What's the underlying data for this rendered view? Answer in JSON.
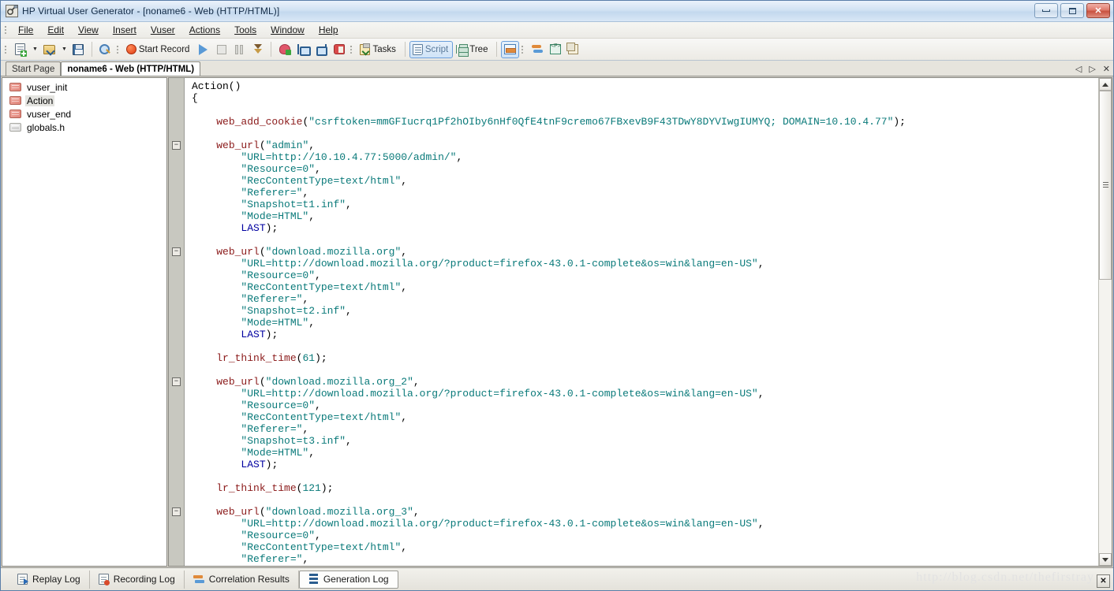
{
  "window": {
    "title": "HP Virtual User Generator - [noname6 - Web (HTTP/HTML)]",
    "app_icon": "vugen-app-icon",
    "controls": {
      "minimize": "minimize-button",
      "restore": "restore-button",
      "close": "✕"
    }
  },
  "menubar": {
    "items": [
      {
        "label": "File"
      },
      {
        "label": "Edit"
      },
      {
        "label": "View"
      },
      {
        "label": "Insert"
      },
      {
        "label": "Vuser"
      },
      {
        "label": "Actions"
      },
      {
        "label": "Tools"
      },
      {
        "label": "Window"
      },
      {
        "label": "Help"
      }
    ]
  },
  "toolbar": {
    "new_script": "new-script-icon",
    "open_script": "open-folder-icon",
    "save_script": "save-floppy-icon",
    "find": "find-zoom-icon",
    "start_record_label": "Start Record",
    "run": "run-play-icon",
    "stop": "stop-icon",
    "pause": "pause-icon",
    "step_down": "step-down-icon",
    "design_studio": "design-studio-icon",
    "step_into": "step-into-icon",
    "step_out": "step-out-icon",
    "breakpoint": "breakpoint-icon",
    "tasks_label": "Tasks",
    "script_label": "Script",
    "tree_label": "Tree",
    "split_view": "split-view-icon",
    "sync_icon": "sync-icon",
    "parameter_icon": "parameter-icon",
    "copy_icon": "copy-icon"
  },
  "doctabs": {
    "tabs": [
      {
        "label": "Start Page",
        "active": false
      },
      {
        "label": "noname6 - Web (HTTP/HTML)",
        "active": true
      }
    ],
    "nav": {
      "prev": "◁",
      "next": "▷",
      "close": "✕"
    }
  },
  "tree": {
    "items": [
      {
        "label": "vuser_init",
        "icon": "action-brick-icon",
        "selected": false
      },
      {
        "label": "Action",
        "icon": "action-brick-icon",
        "selected": true
      },
      {
        "label": "vuser_end",
        "icon": "action-brick-icon",
        "selected": false
      },
      {
        "label": "globals.h",
        "icon": "header-file-icon",
        "selected": false
      }
    ]
  },
  "editor": {
    "code_lines": [
      [
        {
          "t": "Action()",
          "c": "pun"
        }
      ],
      [
        {
          "t": "{",
          "c": "pun"
        }
      ],
      [],
      [
        {
          "t": "    ",
          "c": "pun"
        },
        {
          "t": "web_add_cookie",
          "c": "fn"
        },
        {
          "t": "(",
          "c": "pun"
        },
        {
          "t": "\"csrftoken=mmGFIucrq1Pf2hOIby6nHf0QfE4tnF9cremo67FBxevB9F43TDwY8DYVIwgIUMYQ; DOMAIN=10.10.4.77\"",
          "c": "str"
        },
        {
          "t": ");",
          "c": "pun"
        }
      ],
      [],
      [
        {
          "t": "    ",
          "c": "pun"
        },
        {
          "t": "web_url",
          "c": "fn"
        },
        {
          "t": "(",
          "c": "pun"
        },
        {
          "t": "\"admin\"",
          "c": "str"
        },
        {
          "t": ",",
          "c": "pun"
        }
      ],
      [
        {
          "t": "        ",
          "c": "pun"
        },
        {
          "t": "\"URL=http://10.10.4.77:5000/admin/\"",
          "c": "str"
        },
        {
          "t": ",",
          "c": "pun"
        }
      ],
      [
        {
          "t": "        ",
          "c": "pun"
        },
        {
          "t": "\"Resource=0\"",
          "c": "str"
        },
        {
          "t": ",",
          "c": "pun"
        }
      ],
      [
        {
          "t": "        ",
          "c": "pun"
        },
        {
          "t": "\"RecContentType=text/html\"",
          "c": "str"
        },
        {
          "t": ",",
          "c": "pun"
        }
      ],
      [
        {
          "t": "        ",
          "c": "pun"
        },
        {
          "t": "\"Referer=\"",
          "c": "str"
        },
        {
          "t": ",",
          "c": "pun"
        }
      ],
      [
        {
          "t": "        ",
          "c": "pun"
        },
        {
          "t": "\"Snapshot=t1.inf\"",
          "c": "str"
        },
        {
          "t": ",",
          "c": "pun"
        }
      ],
      [
        {
          "t": "        ",
          "c": "pun"
        },
        {
          "t": "\"Mode=HTML\"",
          "c": "str"
        },
        {
          "t": ",",
          "c": "pun"
        }
      ],
      [
        {
          "t": "        ",
          "c": "pun"
        },
        {
          "t": "LAST",
          "c": "kw"
        },
        {
          "t": ");",
          "c": "pun"
        }
      ],
      [],
      [
        {
          "t": "    ",
          "c": "pun"
        },
        {
          "t": "web_url",
          "c": "fn"
        },
        {
          "t": "(",
          "c": "pun"
        },
        {
          "t": "\"download.mozilla.org\"",
          "c": "str"
        },
        {
          "t": ",",
          "c": "pun"
        }
      ],
      [
        {
          "t": "        ",
          "c": "pun"
        },
        {
          "t": "\"URL=http://download.mozilla.org/?product=firefox-43.0.1-complete&os=win&lang=en-US\"",
          "c": "str"
        },
        {
          "t": ",",
          "c": "pun"
        }
      ],
      [
        {
          "t": "        ",
          "c": "pun"
        },
        {
          "t": "\"Resource=0\"",
          "c": "str"
        },
        {
          "t": ",",
          "c": "pun"
        }
      ],
      [
        {
          "t": "        ",
          "c": "pun"
        },
        {
          "t": "\"RecContentType=text/html\"",
          "c": "str"
        },
        {
          "t": ",",
          "c": "pun"
        }
      ],
      [
        {
          "t": "        ",
          "c": "pun"
        },
        {
          "t": "\"Referer=\"",
          "c": "str"
        },
        {
          "t": ",",
          "c": "pun"
        }
      ],
      [
        {
          "t": "        ",
          "c": "pun"
        },
        {
          "t": "\"Snapshot=t2.inf\"",
          "c": "str"
        },
        {
          "t": ",",
          "c": "pun"
        }
      ],
      [
        {
          "t": "        ",
          "c": "pun"
        },
        {
          "t": "\"Mode=HTML\"",
          "c": "str"
        },
        {
          "t": ",",
          "c": "pun"
        }
      ],
      [
        {
          "t": "        ",
          "c": "pun"
        },
        {
          "t": "LAST",
          "c": "kw"
        },
        {
          "t": ");",
          "c": "pun"
        }
      ],
      [],
      [
        {
          "t": "    ",
          "c": "pun"
        },
        {
          "t": "lr_think_time",
          "c": "fn"
        },
        {
          "t": "(",
          "c": "pun"
        },
        {
          "t": "61",
          "c": "num"
        },
        {
          "t": ");",
          "c": "pun"
        }
      ],
      [],
      [
        {
          "t": "    ",
          "c": "pun"
        },
        {
          "t": "web_url",
          "c": "fn"
        },
        {
          "t": "(",
          "c": "pun"
        },
        {
          "t": "\"download.mozilla.org_2\"",
          "c": "str"
        },
        {
          "t": ",",
          "c": "pun"
        }
      ],
      [
        {
          "t": "        ",
          "c": "pun"
        },
        {
          "t": "\"URL=http://download.mozilla.org/?product=firefox-43.0.1-complete&os=win&lang=en-US\"",
          "c": "str"
        },
        {
          "t": ",",
          "c": "pun"
        }
      ],
      [
        {
          "t": "        ",
          "c": "pun"
        },
        {
          "t": "\"Resource=0\"",
          "c": "str"
        },
        {
          "t": ",",
          "c": "pun"
        }
      ],
      [
        {
          "t": "        ",
          "c": "pun"
        },
        {
          "t": "\"RecContentType=text/html\"",
          "c": "str"
        },
        {
          "t": ",",
          "c": "pun"
        }
      ],
      [
        {
          "t": "        ",
          "c": "pun"
        },
        {
          "t": "\"Referer=\"",
          "c": "str"
        },
        {
          "t": ",",
          "c": "pun"
        }
      ],
      [
        {
          "t": "        ",
          "c": "pun"
        },
        {
          "t": "\"Snapshot=t3.inf\"",
          "c": "str"
        },
        {
          "t": ",",
          "c": "pun"
        }
      ],
      [
        {
          "t": "        ",
          "c": "pun"
        },
        {
          "t": "\"Mode=HTML\"",
          "c": "str"
        },
        {
          "t": ",",
          "c": "pun"
        }
      ],
      [
        {
          "t": "        ",
          "c": "pun"
        },
        {
          "t": "LAST",
          "c": "kw"
        },
        {
          "t": ");",
          "c": "pun"
        }
      ],
      [],
      [
        {
          "t": "    ",
          "c": "pun"
        },
        {
          "t": "lr_think_time",
          "c": "fn"
        },
        {
          "t": "(",
          "c": "pun"
        },
        {
          "t": "121",
          "c": "num"
        },
        {
          "t": ");",
          "c": "pun"
        }
      ],
      [],
      [
        {
          "t": "    ",
          "c": "pun"
        },
        {
          "t": "web_url",
          "c": "fn"
        },
        {
          "t": "(",
          "c": "pun"
        },
        {
          "t": "\"download.mozilla.org_3\"",
          "c": "str"
        },
        {
          "t": ",",
          "c": "pun"
        }
      ],
      [
        {
          "t": "        ",
          "c": "pun"
        },
        {
          "t": "\"URL=http://download.mozilla.org/?product=firefox-43.0.1-complete&os=win&lang=en-US\"",
          "c": "str"
        },
        {
          "t": ",",
          "c": "pun"
        }
      ],
      [
        {
          "t": "        ",
          "c": "pun"
        },
        {
          "t": "\"Resource=0\"",
          "c": "str"
        },
        {
          "t": ",",
          "c": "pun"
        }
      ],
      [
        {
          "t": "        ",
          "c": "pun"
        },
        {
          "t": "\"RecContentType=text/html\"",
          "c": "str"
        },
        {
          "t": ",",
          "c": "pun"
        }
      ],
      [
        {
          "t": "        ",
          "c": "pun"
        },
        {
          "t": "\"Referer=\"",
          "c": "str"
        },
        {
          "t": ",",
          "c": "pun"
        }
      ]
    ],
    "fold_markers": [
      5,
      14,
      25,
      36
    ],
    "fold_glyph": "−"
  },
  "bottom_tabs": {
    "tabs": [
      {
        "label": "Replay Log",
        "icon": "replay-log-icon",
        "active": false
      },
      {
        "label": "Recording Log",
        "icon": "recording-log-icon",
        "active": false
      },
      {
        "label": "Correlation Results",
        "icon": "correlation-results-icon",
        "active": false
      },
      {
        "label": "Generation Log",
        "icon": "generation-log-icon",
        "active": true
      }
    ],
    "watermark": "http://blog.csdn.net/thefirstray",
    "resizer": "✕"
  },
  "colors": {
    "function": "#8b1a1a",
    "string": "#0a7a7a",
    "keyword": "#0000a0",
    "title_bar": "#d2e2f3",
    "close_button": "#c8513f"
  }
}
